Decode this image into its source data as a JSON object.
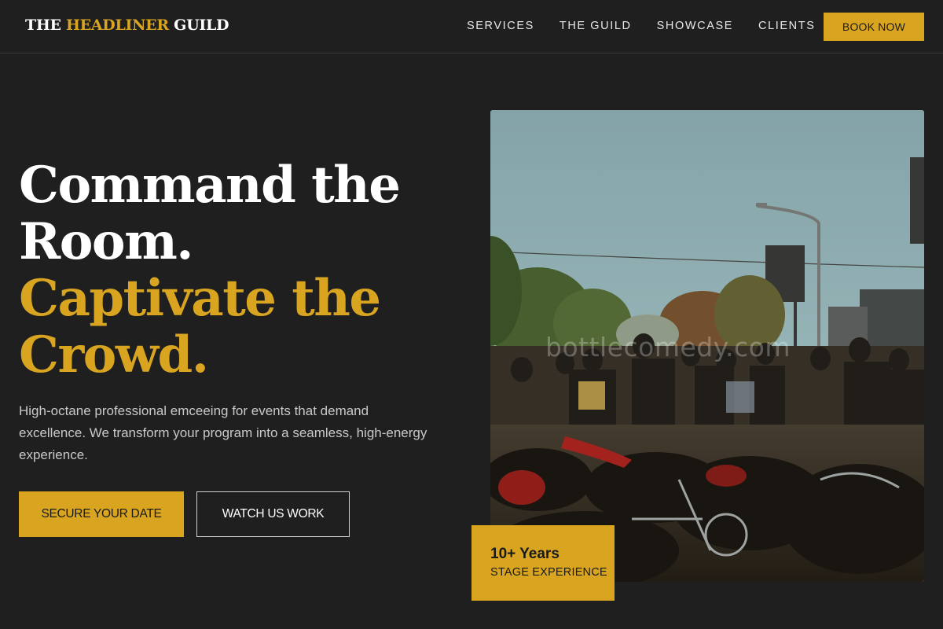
{
  "header": {
    "logo": {
      "part1": "THE ",
      "part2": "HEADLINER",
      "part3": " GUILD"
    },
    "nav": [
      "SERVICES",
      "THE GUILD",
      "SHOWCASE",
      "CLIENTS"
    ],
    "book_label": "BOOK NOW"
  },
  "hero": {
    "headline": {
      "line1": "Command the",
      "line2": "Room.",
      "line3": "Captivate the",
      "line4": "Crowd."
    },
    "subcopy": "High-octane professional emceeing for events that demand excellence. We transform your program into a seamless, high-energy experience.",
    "primary_cta": "SECURE YOUR DATE",
    "secondary_cta": "WATCH US WORK",
    "image": {
      "subject": "crowd-with-motorcycles-photo",
      "watermark": "bottlecomedy.com"
    },
    "stat": {
      "value": "10+ Years",
      "label": "STAGE EXPERIENCE"
    }
  },
  "colors": {
    "background": "#1f1f1f",
    "accent": "#d9a521",
    "text": "#ffffff",
    "muted_text": "#c9c9c9"
  }
}
